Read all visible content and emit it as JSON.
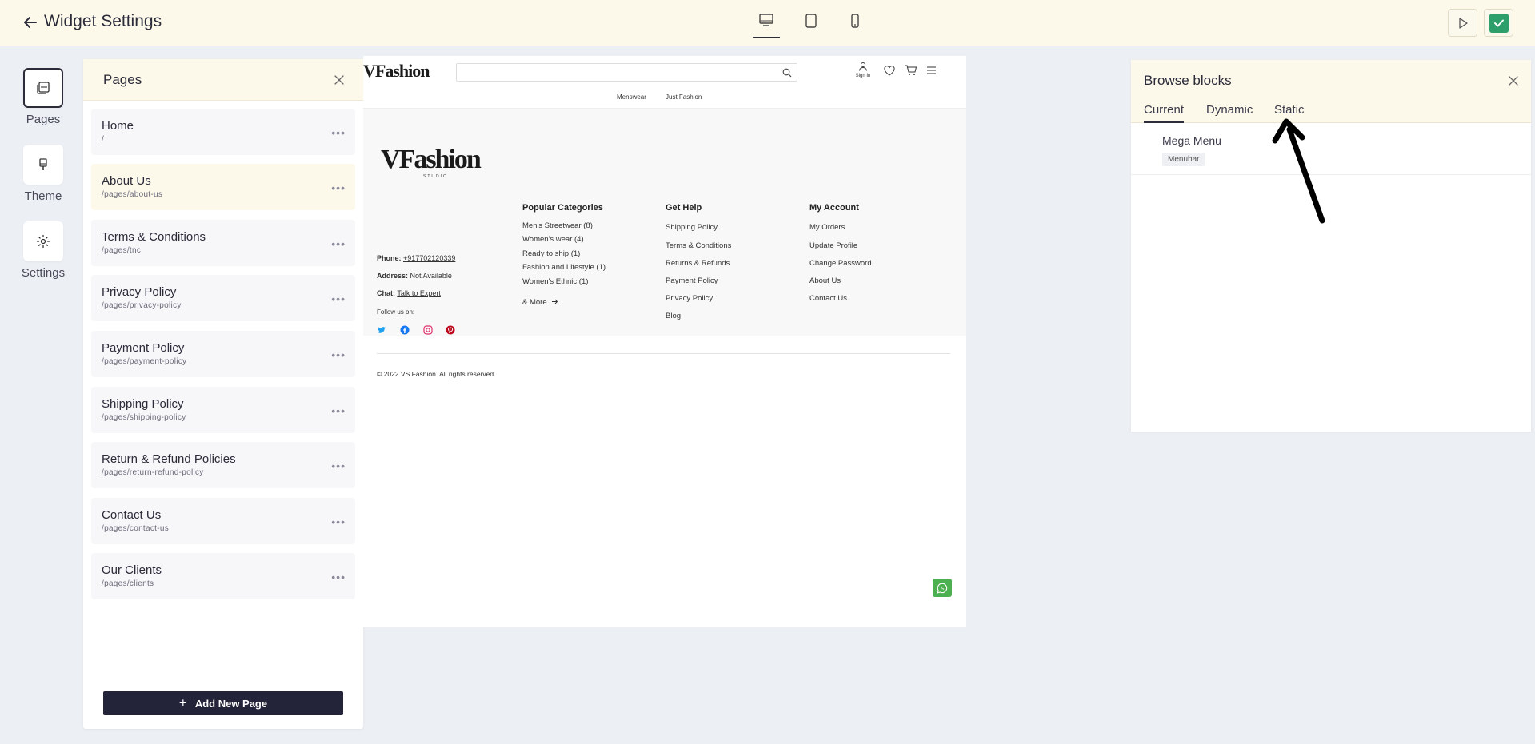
{
  "topbar": {
    "title": "Widget Settings",
    "devices": [
      "desktop-icon",
      "tablet-icon",
      "mobile-icon"
    ],
    "active_device": "desktop"
  },
  "rail": {
    "items": [
      {
        "label": "Pages",
        "icon": "pages-icon",
        "active": true
      },
      {
        "label": "Theme",
        "icon": "theme-icon",
        "active": false
      },
      {
        "label": "Settings",
        "icon": "gear-icon",
        "active": false
      }
    ]
  },
  "pages_panel": {
    "title": "Pages",
    "items": [
      {
        "name": "Home",
        "path": "/"
      },
      {
        "name": "About Us",
        "path": "/pages/about-us"
      },
      {
        "name": "Terms & Conditions",
        "path": "/pages/tnc"
      },
      {
        "name": "Privacy Policy",
        "path": "/pages/privacy-policy"
      },
      {
        "name": "Payment Policy",
        "path": "/pages/payment-policy"
      },
      {
        "name": "Shipping Policy",
        "path": "/pages/shipping-policy"
      },
      {
        "name": "Return & Refund Policies",
        "path": "/pages/return-refund-policy"
      },
      {
        "name": "Contact Us",
        "path": "/pages/contact-us"
      },
      {
        "name": "Our Clients",
        "path": "/pages/clients"
      }
    ],
    "more_glyph": "•••",
    "add_label": "Add New Page",
    "add_glyph": "+"
  },
  "preview": {
    "logo": "VFashion",
    "logo_sub": "STUDIO",
    "sign_in": "Sign In",
    "nav": [
      "Menswear",
      "Just Fashion"
    ],
    "contact": {
      "phone_label": "Phone:",
      "phone": "+917702120339",
      "address_label": "Address:",
      "address": "Not Available",
      "chat_label": "Chat:",
      "chat": "Talk to Expert",
      "follow": "Follow us on:"
    },
    "popular": {
      "title": "Popular Categories",
      "links": [
        "Men's Streetwear (8)",
        "Women's wear (4)",
        "Ready to ship (1)",
        "Fashion and Lifestyle (1)",
        "Women's Ethnic (1)"
      ],
      "more": "& More"
    },
    "help": {
      "title": "Get Help",
      "links": [
        "Shipping Policy",
        "Terms & Conditions",
        "Returns & Refunds",
        "Payment Policy",
        "Privacy Policy",
        "Blog"
      ]
    },
    "account": {
      "title": "My Account",
      "links": [
        "My Orders",
        "Update Profile",
        "Change Password",
        "About Us",
        "Contact Us"
      ]
    },
    "copyright": "© 2022 VS Fashion. All rights reserved"
  },
  "browse": {
    "title": "Browse blocks",
    "tabs": [
      "Current",
      "Dynamic",
      "Static"
    ],
    "active_tab": "Current",
    "block": {
      "name": "Mega Menu",
      "tag": "Menubar"
    }
  },
  "colors": {
    "topbar_bg": "#fdf9ea",
    "confirm": "#2e9e6a",
    "dark_button": "#23233a"
  }
}
